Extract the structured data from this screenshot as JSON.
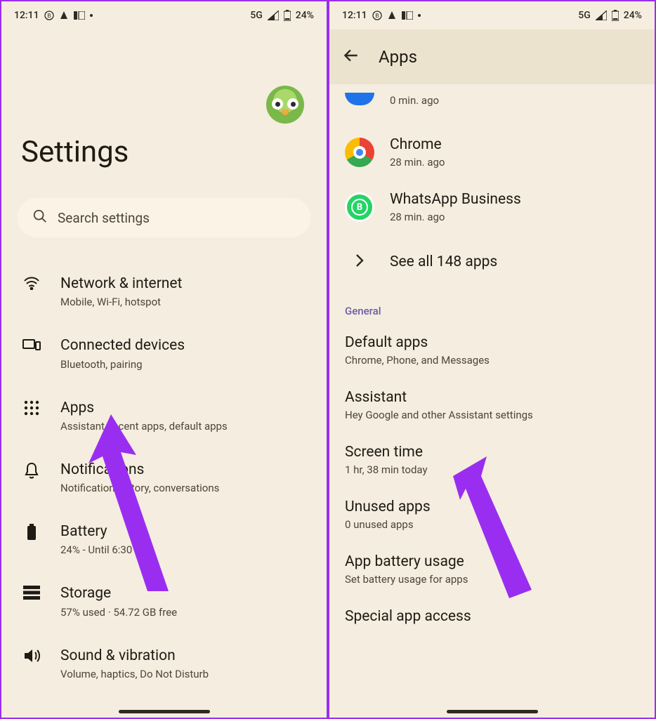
{
  "status": {
    "time": "12:11",
    "network_label": "5G",
    "battery_percent": "24%"
  },
  "left": {
    "page_title": "Settings",
    "search_placeholder": "Search settings",
    "items": [
      {
        "title": "Network & internet",
        "sub": "Mobile, Wi-Fi, hotspot"
      },
      {
        "title": "Connected devices",
        "sub": "Bluetooth, pairing"
      },
      {
        "title": "Apps",
        "sub": "Assistant, recent apps, default apps"
      },
      {
        "title": "Notifications",
        "sub": "Notification history, conversations"
      },
      {
        "title": "Battery",
        "sub": "24% - Until 6:30 PM"
      },
      {
        "title": "Storage",
        "sub": "57% used · 54.72 GB free"
      },
      {
        "title": "Sound & vibration",
        "sub": "Volume, haptics, Do Not Disturb"
      }
    ]
  },
  "right": {
    "header_title": "Apps",
    "recent": [
      {
        "name_partial_sub": "0 min. ago"
      },
      {
        "name": "Chrome",
        "sub": "28 min. ago"
      },
      {
        "name": "WhatsApp Business",
        "sub": "28 min. ago"
      }
    ],
    "see_all_label": "See all 148 apps",
    "section_general": "General",
    "general_items": [
      {
        "title": "Default apps",
        "sub": "Chrome, Phone, and Messages"
      },
      {
        "title": "Assistant",
        "sub": "Hey Google and other Assistant settings"
      },
      {
        "title": "Screen time",
        "sub": "1 hr, 38 min today"
      },
      {
        "title": "Unused apps",
        "sub": "0 unused apps"
      },
      {
        "title": "App battery usage",
        "sub": "Set battery usage for apps"
      },
      {
        "title": "Special app access",
        "sub": ""
      }
    ]
  }
}
